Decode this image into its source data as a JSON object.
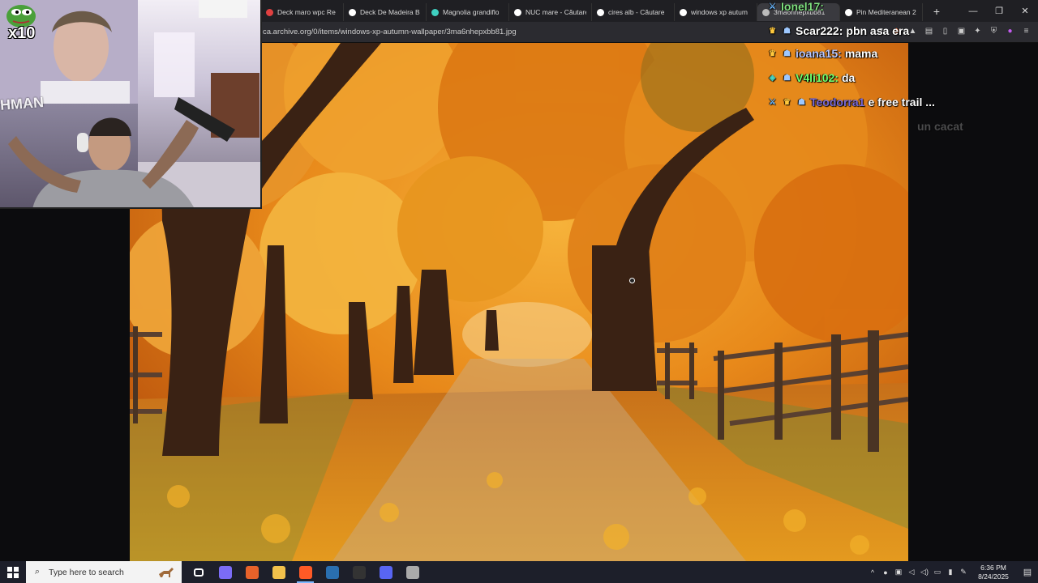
{
  "tabs": [
    {
      "title": "Deck maro wpc Re",
      "fav_color": "#e04040",
      "active": false
    },
    {
      "title": "Deck De Madeira B",
      "fav_color": "#ffffff",
      "active": false
    },
    {
      "title": "Magnolia grandiflo",
      "fav_color": "#3fd0c0",
      "active": false
    },
    {
      "title": "NUC mare - Căutare",
      "fav_color": "#ffffff",
      "active": false
    },
    {
      "title": "cires alb - Căutare",
      "fav_color": "#ffffff",
      "active": false
    },
    {
      "title": "windows xp autum",
      "fav_color": "#ffffff",
      "active": false
    },
    {
      "title": "3ma6nhepxbb81",
      "fav_color": "#bbbbbb",
      "active": true
    },
    {
      "title": "Pin Mediteranean 2",
      "fav_color": "#ffffff",
      "active": false
    }
  ],
  "window_controls": {
    "minimize": "—",
    "restore": "❐",
    "close": "✕",
    "new_tab": "+"
  },
  "address_bar": {
    "url": "ca.archive.org/0/items/windows-xp-autumn-wallpaper/3ma6nhepxbb81.jpg"
  },
  "webcam": {
    "emote_label": "x10",
    "banner_text": "HMAN"
  },
  "chat": [
    {
      "user": "Ionel17:",
      "message": "",
      "user_color": "#7fe07f",
      "badges": [
        "sword"
      ],
      "faded": false
    },
    {
      "user": "Scar222:",
      "message": "pbn asa era",
      "user_color": "#ffffff",
      "badges": [
        "crown",
        "robot"
      ],
      "faded": false
    },
    {
      "user": "ioana15:",
      "message": "mama",
      "user_color": "#b8c7ff",
      "badges": [
        "crown",
        "robot"
      ],
      "faded": false
    },
    {
      "user": "V4li102:",
      "message": "da",
      "user_color": "#6fff6f",
      "badges": [
        "sub",
        "robot"
      ],
      "faded": false
    },
    {
      "user": "Teodorra1",
      "message": "e free trail ...",
      "user_color": "#7a6bd6",
      "badges": [
        "sword",
        "crown",
        "robot"
      ],
      "faded": false
    },
    {
      "user": "",
      "message": "un cacat",
      "user_color": "#888888",
      "badges": [],
      "faded": true
    }
  ],
  "taskbar": {
    "search_placeholder": "Type here to search",
    "apps": [
      {
        "name": "task-view",
        "color": "#ffffff",
        "active": false
      },
      {
        "name": "copilot",
        "color": "#7b6cf6",
        "active": false
      },
      {
        "name": "microsoft-365",
        "color": "#e8622a",
        "active": false
      },
      {
        "name": "file-explorer",
        "color": "#f2c14b",
        "active": false
      },
      {
        "name": "brave",
        "color": "#ff5a26",
        "active": true
      },
      {
        "name": "steam",
        "color": "#2a6fb0",
        "active": false
      },
      {
        "name": "terminal",
        "color": "#333333",
        "active": false
      },
      {
        "name": "discord",
        "color": "#5865f2",
        "active": false
      },
      {
        "name": "obs",
        "color": "#aaaaaa",
        "active": false
      }
    ],
    "time": "6:36 PM",
    "date": "8/24/2025"
  }
}
